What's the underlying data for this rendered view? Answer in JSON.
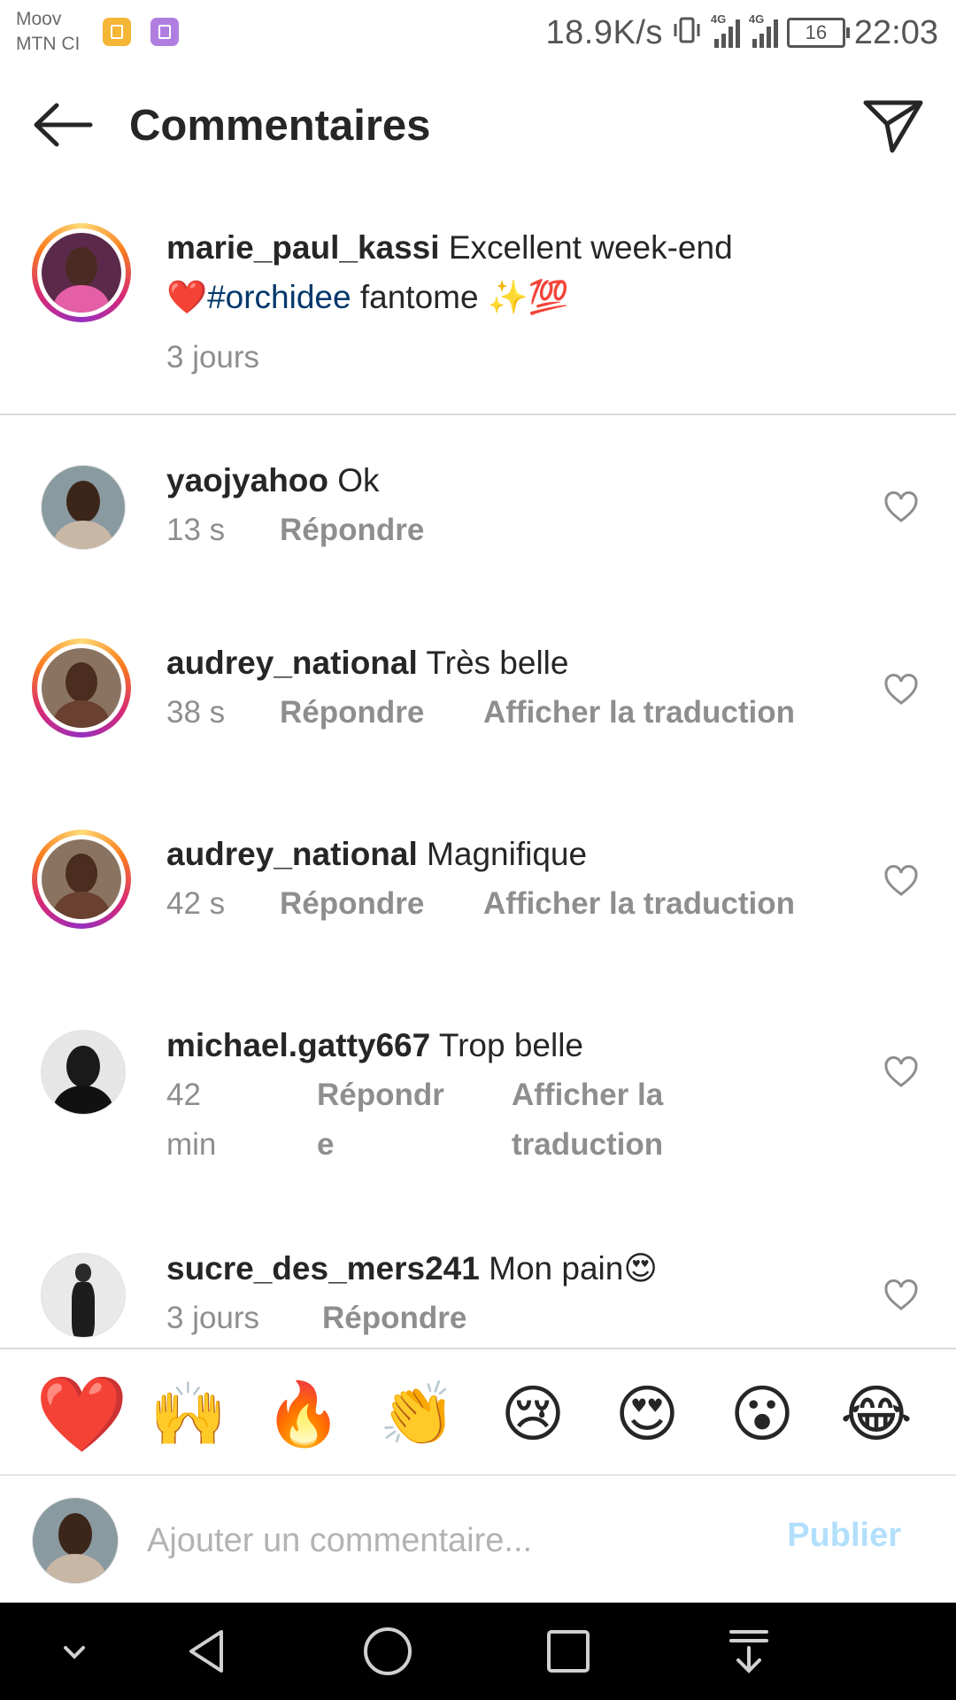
{
  "status_bar": {
    "carrier_1": "Moov",
    "carrier_2": "MTN CI",
    "net_speed": "18.9K/s",
    "network_1": "4G",
    "network_2": "4G",
    "battery": "16",
    "time": "22:03"
  },
  "header": {
    "title": "Commentaires",
    "back_icon": "arrow-left-icon",
    "share_icon": "paper-plane-icon"
  },
  "caption": {
    "username": "marie_paul_kassi",
    "text_1": "Excellent week-end",
    "emoji_heart": "❤️",
    "hashtag": "#orchidee",
    "text_2": "fantome",
    "emoji_end": "✨💯",
    "time": "3 jours"
  },
  "comments": [
    {
      "username": "yaojyahoo",
      "text": "Ok",
      "time": "13 s",
      "reply": "Répondre"
    },
    {
      "username": "audrey_national",
      "text": "Très belle",
      "time": "38 s",
      "reply": "Répondre",
      "translate": "Afficher la traduction"
    },
    {
      "username": "audrey_national",
      "text": "Magnifique",
      "time": "42 s",
      "reply": "Répondre",
      "translate": "Afficher la traduction"
    },
    {
      "username": "michael.gatty667",
      "text": "Trop belle",
      "time": "42 min",
      "reply": "Répondre",
      "translate": "Afficher la traduction"
    },
    {
      "username": "sucre_des_mers241",
      "text": "Mon pain😍",
      "time": "3 jours",
      "reply": "Répondre"
    }
  ],
  "emoji_bar": [
    "❤️",
    "🙌",
    "🔥",
    "👏",
    "😢",
    "😍",
    "😮",
    "😂"
  ],
  "composer": {
    "placeholder": "Ajouter un commentaire...",
    "publish": "Publier"
  },
  "colors": {
    "text": "#262626",
    "muted": "#8e8e8e",
    "hashtag": "#00376b",
    "publish_disabled": "#b2dffc",
    "story_ring": "#d62976"
  }
}
